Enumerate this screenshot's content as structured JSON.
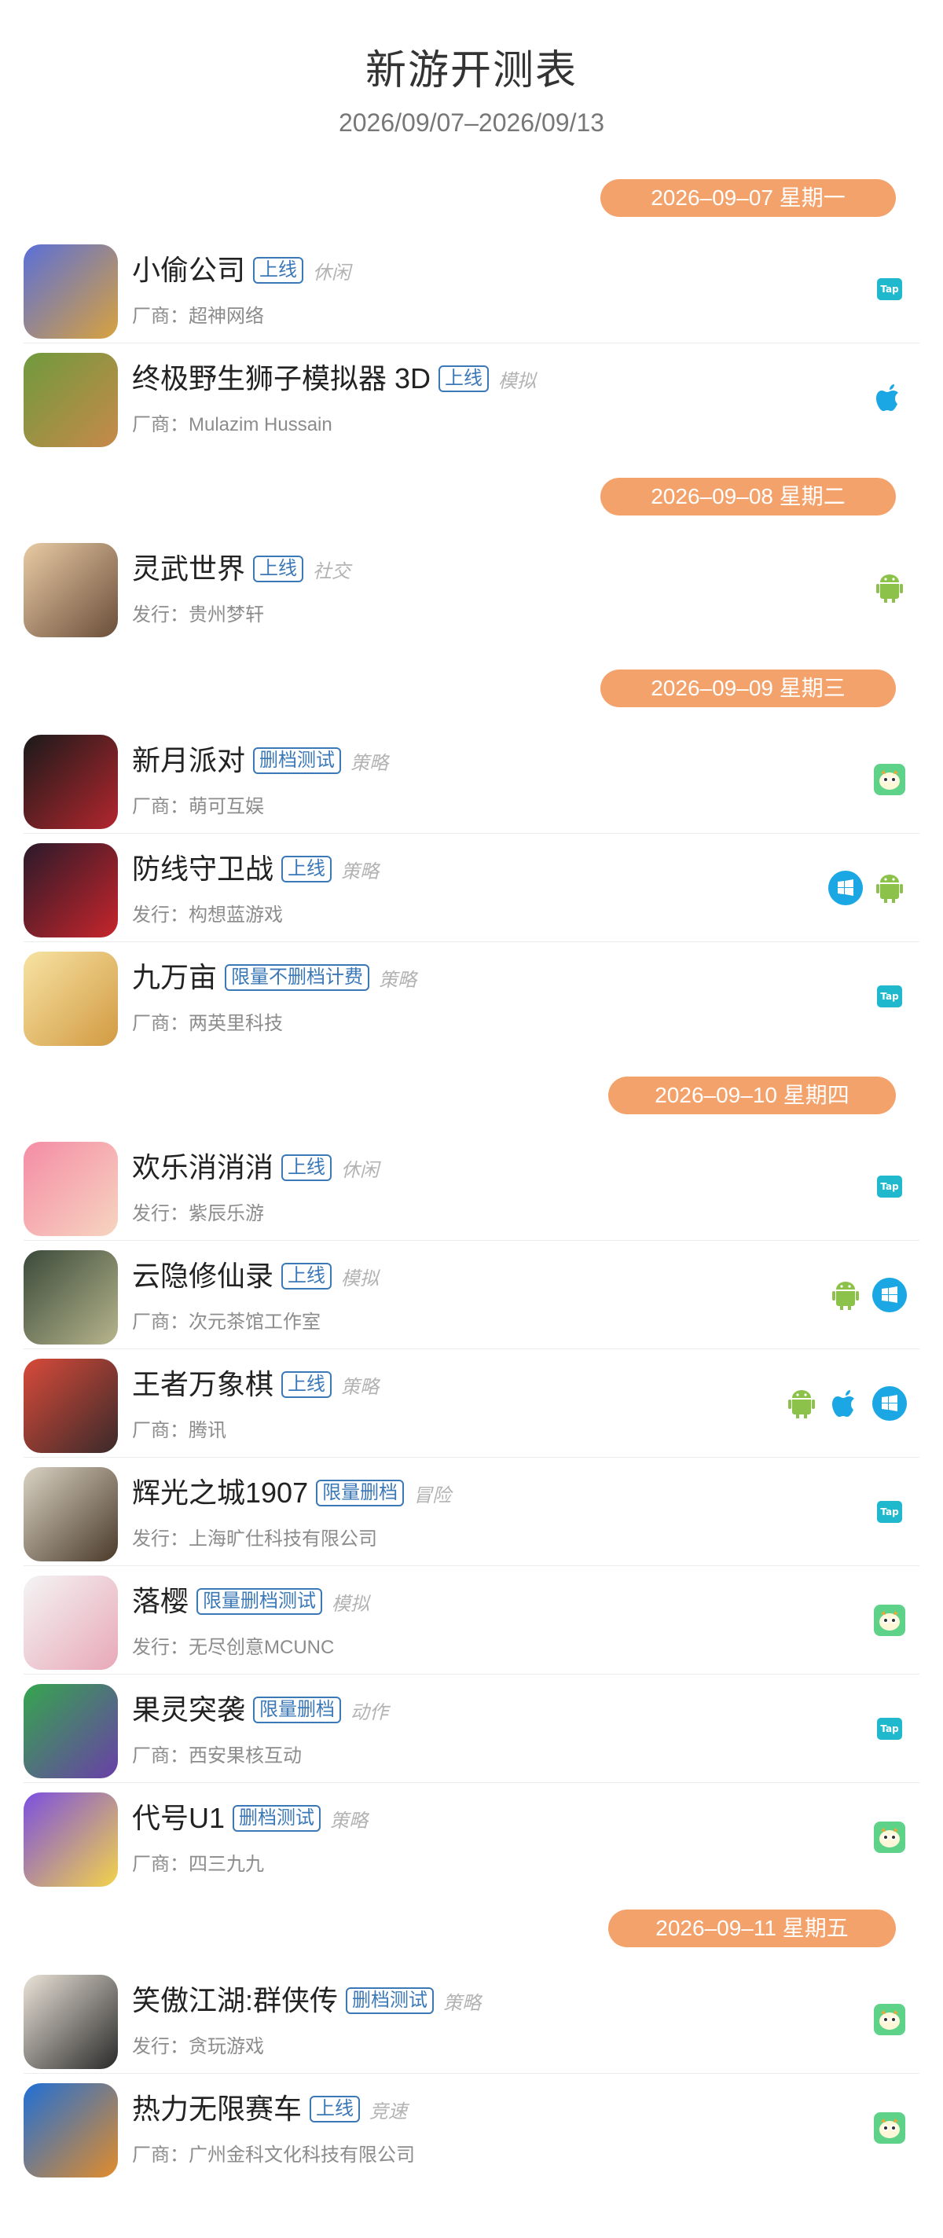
{
  "header": {
    "title": "新游开测表",
    "range": "2026/09/07–2026/09/13"
  },
  "sections": [
    {
      "date": "2026–09–07 星期一",
      "games": [
        {
          "name": "小偷公司",
          "tag": "上线",
          "genre": "休闲",
          "company": "厂商：超神网络",
          "platforms": [
            "tap"
          ]
        },
        {
          "name": "终极野生狮子模拟器 3D",
          "tag": "上线",
          "genre": "模拟",
          "company": "厂商：Mulazim Hussain",
          "platforms": [
            "ios"
          ]
        }
      ]
    },
    {
      "date": "2026–09–08 星期二",
      "games": [
        {
          "name": "灵武世界",
          "tag": "上线",
          "genre": "社交",
          "company": "发行：贵州梦轩",
          "platforms": [
            "android"
          ]
        }
      ]
    },
    {
      "date": "2026–09–09 星期三",
      "games": [
        {
          "name": "新月派对",
          "tag": "删档测试",
          "genre": "策略",
          "company": "厂商：萌可互娱",
          "platforms": [
            "kuaibao"
          ]
        },
        {
          "name": "防线守卫战",
          "tag": "上线",
          "genre": "策略",
          "company": "发行：构想蓝游戏",
          "platforms": [
            "windows",
            "android"
          ]
        },
        {
          "name": "九万亩",
          "tag": "限量不删档计费",
          "genre": "策略",
          "company": "厂商：两英里科技",
          "platforms": [
            "tap"
          ]
        }
      ]
    },
    {
      "date": "2026–09–10 星期四",
      "games": [
        {
          "name": "欢乐消消消",
          "tag": "上线",
          "genre": "休闲",
          "company": "发行：紫辰乐游",
          "platforms": [
            "tap"
          ]
        },
        {
          "name": "云隐修仙录",
          "tag": "上线",
          "genre": "模拟",
          "company": "厂商：次元茶馆工作室",
          "platforms": [
            "android",
            "windows"
          ]
        },
        {
          "name": "王者万象棋",
          "tag": "上线",
          "genre": "策略",
          "company": "厂商：腾讯",
          "platforms": [
            "android",
            "ios",
            "windows"
          ]
        },
        {
          "name": "辉光之城1907",
          "tag": "限量删档",
          "genre": "冒险",
          "company": "发行：上海旷仕科技有限公司",
          "platforms": [
            "tap"
          ]
        },
        {
          "name": "落樱",
          "tag": "限量删档测试",
          "genre": "模拟",
          "company": "发行：无尽创意MCUNC",
          "platforms": [
            "kuaibao"
          ]
        },
        {
          "name": "果灵突袭",
          "tag": "限量删档",
          "genre": "动作",
          "company": "厂商：西安果核互动",
          "platforms": [
            "tap"
          ]
        },
        {
          "name": "代号U1",
          "tag": "删档测试",
          "genre": "策略",
          "company": "厂商：四三九九",
          "platforms": [
            "kuaibao"
          ]
        }
      ]
    },
    {
      "date": "2026–09–11 星期五",
      "games": [
        {
          "name": "笑傲江湖:群侠传",
          "tag": "删档测试",
          "genre": "策略",
          "company": "发行：贪玩游戏",
          "platforms": [
            "kuaibao"
          ]
        },
        {
          "name": "热力无限赛车",
          "tag": "上线",
          "genre": "竞速",
          "company": "厂商：广州金科文化科技有限公司",
          "platforms": [
            "kuaibao"
          ]
        }
      ]
    }
  ],
  "platform_icons": {
    "tap": "Tap",
    "ios": "apple-icon",
    "android": "android-icon",
    "windows": "windows-icon",
    "kuaibao": "kuaibao-icon"
  },
  "colors": {
    "date_pill": "#f4a26b",
    "tag_border": "#3b78b8",
    "tap": "#1fb8cc",
    "android": "#8cc24a",
    "ios_windows": "#1aa7e3",
    "kuaibao": "#5fd28a"
  }
}
